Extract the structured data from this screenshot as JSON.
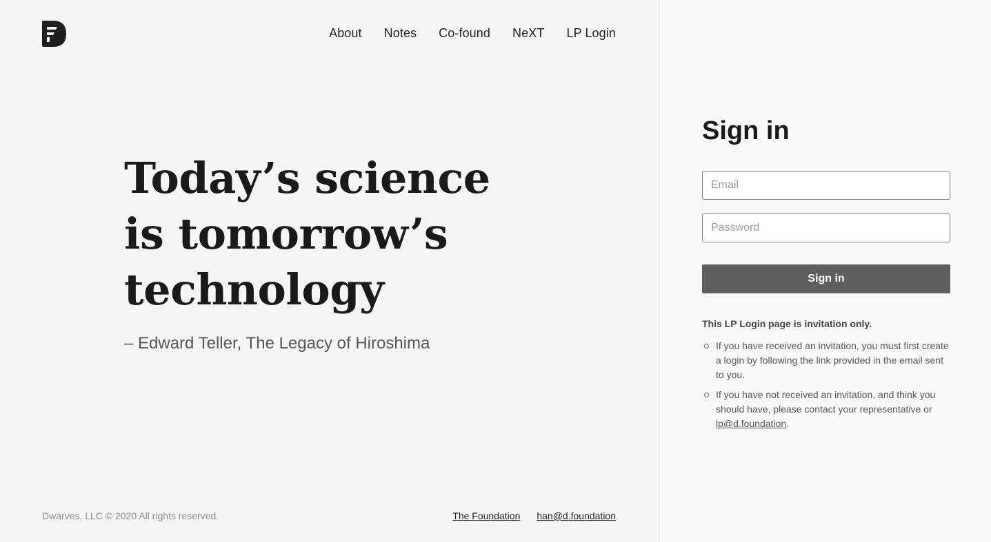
{
  "nav": {
    "items": [
      "About",
      "Notes",
      "Co-found",
      "NeXT",
      "LP Login"
    ]
  },
  "hero": {
    "quote_lines": [
      "Today’s science",
      "is tomorrow’s",
      "technology"
    ],
    "attribution": "– Edward Teller, The Legacy of Hiroshima"
  },
  "footer": {
    "copyright": "Dwarves, LLC © 2020 All rights reserved.",
    "links": [
      "The Foundation",
      "han@d.foundation"
    ]
  },
  "signin": {
    "title": "Sign in",
    "email_placeholder": "Email",
    "password_placeholder": "Password",
    "submit_label": "Sign in",
    "notice_title": "This LP Login page is invitation only.",
    "notice_1": "If you have received an invitation, you must first create a login by following the link provided in the email sent to you.",
    "notice_2_text": "If you have not received an invitation, and think you should have, please contact your representative or ",
    "notice_2_link": "lp@d.foundation",
    "notice_2_end": "."
  },
  "colors": {
    "background": "#f5f5f5",
    "button": "#5f5f5f",
    "text": "#1f1f1f"
  }
}
